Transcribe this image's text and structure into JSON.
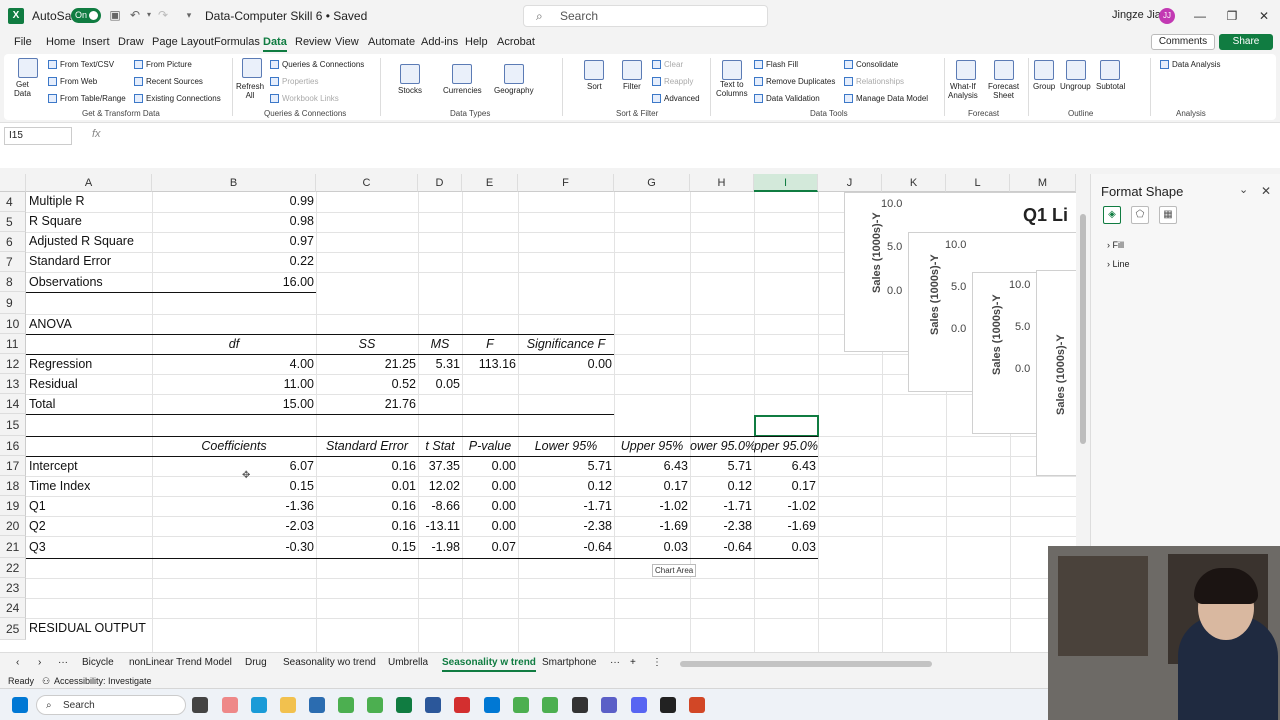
{
  "titlebar": {
    "autosave_label": "AutoSave",
    "autosave_state": "On",
    "doc_title": "Data-Computer Skill 6 • Saved",
    "search_placeholder": "Search",
    "user_name": "Jingze Jiang",
    "user_initials": "JJ"
  },
  "menu": {
    "tabs": [
      "File",
      "Home",
      "Insert",
      "Draw",
      "Page Layout",
      "Formulas",
      "Data",
      "Review",
      "View",
      "Automate",
      "Add-ins",
      "Help",
      "Acrobat"
    ],
    "active": "Data",
    "comments": "Comments",
    "share": "Share"
  },
  "ribbon": {
    "get_data": "Get\nData",
    "from_text_csv": "From Text/CSV",
    "from_web": "From Web",
    "from_table_range": "From Table/Range",
    "from_picture": "From Picture",
    "recent_sources": "Recent Sources",
    "existing_connections": "Existing Connections",
    "group_get_transform": "Get & Transform Data",
    "refresh_all": "Refresh\nAll",
    "queries_connections": "Queries & Connections",
    "properties": "Properties",
    "workbook_links": "Workbook Links",
    "group_queries": "Queries & Connections",
    "stocks": "Stocks",
    "currencies": "Currencies",
    "geography": "Geography",
    "group_data_types": "Data Types",
    "sort": "Sort",
    "filter": "Filter",
    "clear": "Clear",
    "reapply": "Reapply",
    "advanced": "Advanced",
    "group_sort_filter": "Sort & Filter",
    "text_to_columns": "Text to\nColumns",
    "flash_fill": "Flash Fill",
    "remove_duplicates": "Remove Duplicates",
    "data_validation": "Data Validation",
    "consolidate": "Consolidate",
    "relationships": "Relationships",
    "manage_data_model": "Manage Data Model",
    "group_data_tools": "Data Tools",
    "what_if": "What-If\nAnalysis",
    "forecast_sheet": "Forecast\nSheet",
    "group_forecast": "Forecast",
    "group": "Group",
    "ungroup": "Ungroup",
    "subtotal": "Subtotal",
    "group_outline": "Outline",
    "data_analysis": "Data Analysis",
    "group_analysis": "Analysis"
  },
  "formula_bar": {
    "name_box": "I15",
    "fx": "fx"
  },
  "columns": [
    "A",
    "B",
    "C",
    "D",
    "E",
    "F",
    "G",
    "H",
    "I",
    "J",
    "K",
    "L",
    "M"
  ],
  "selected_column": "I",
  "rows": {
    "numbers": [
      "4",
      "5",
      "6",
      "7",
      "8",
      "9",
      "10",
      "11",
      "12",
      "13",
      "14",
      "15",
      "16",
      "17",
      "18",
      "19",
      "20",
      "21",
      "22",
      "23",
      "24",
      "25"
    ],
    "r4": {
      "a": "Multiple R",
      "b": "0.99"
    },
    "r5": {
      "a": "R Square",
      "b": "0.98"
    },
    "r6": {
      "a": "Adjusted R Square",
      "b": "0.97"
    },
    "r7": {
      "a": "Standard Error",
      "b": "0.22"
    },
    "r8": {
      "a": "Observations",
      "b": "16.00"
    },
    "r10": {
      "a": "ANOVA"
    },
    "r11": {
      "b": "df",
      "c": "SS",
      "d": "MS",
      "e": "F",
      "f": "Significance F"
    },
    "r12": {
      "a": "Regression",
      "b": "4.00",
      "c": "21.25",
      "d": "5.31",
      "e": "113.16",
      "f": "0.00"
    },
    "r13": {
      "a": "Residual",
      "b": "11.00",
      "c": "0.52",
      "d": "0.05"
    },
    "r14": {
      "a": "Total",
      "b": "15.00",
      "c": "21.76"
    },
    "r16": {
      "b": "Coefficients",
      "c": "Standard Error",
      "d": "t Stat",
      "e": "P-value",
      "f": "Lower 95%",
      "g": "Upper 95%",
      "h": "ower 95.0%",
      "i": "pper 95.0%"
    },
    "r17": {
      "a": "Intercept",
      "b": "6.07",
      "c": "0.16",
      "d": "37.35",
      "e": "0.00",
      "f": "5.71",
      "g": "6.43",
      "h": "5.71",
      "i": "6.43"
    },
    "r18": {
      "a": "Time Index",
      "b": "0.15",
      "c": "0.01",
      "d": "12.02",
      "e": "0.00",
      "f": "0.12",
      "g": "0.17",
      "h": "0.12",
      "i": "0.17"
    },
    "r19": {
      "a": "Q1",
      "b": "-1.36",
      "c": "0.16",
      "d": "-8.66",
      "e": "0.00",
      "f": "-1.71",
      "g": "-1.02",
      "h": "-1.71",
      "i": "-1.02"
    },
    "r20": {
      "a": "Q2",
      "b": "-2.03",
      "c": "0.16",
      "d": "-13.11",
      "e": "0.00",
      "f": "-2.38",
      "g": "-1.69",
      "h": "-2.38",
      "i": "-1.69"
    },
    "r21": {
      "a": "Q3",
      "b": "-0.30",
      "c": "0.15",
      "d": "-1.98",
      "e": "0.07",
      "f": "-0.64",
      "g": "0.03",
      "h": "-0.64",
      "i": "0.03"
    },
    "r25": {
      "a": "RESIDUAL OUTPUT"
    }
  },
  "chart_tooltip": "Chart Area",
  "charts": {
    "ylabel": "Sales (1000s)-Y",
    "ticks": [
      "10.0",
      "5.0",
      "0.0"
    ],
    "title_fragment": "Q1 Li"
  },
  "format_pane": {
    "title": "Format Shape",
    "sections": [
      "Fill",
      "Line"
    ]
  },
  "sheets": {
    "tabs": [
      "Bicycle",
      "nonLinear Trend Model",
      "Drug",
      "Seasonality wo trend",
      "Umbrella",
      "Seasonality w trend",
      "Smartphone"
    ],
    "active": "Seasonality w trend"
  },
  "status": {
    "ready": "Ready",
    "accessibility": "Accessibility: Investigate"
  },
  "taskbar": {
    "search": "Search"
  },
  "colors": {
    "accent": "#107c41",
    "avatar": "#c239b3"
  }
}
